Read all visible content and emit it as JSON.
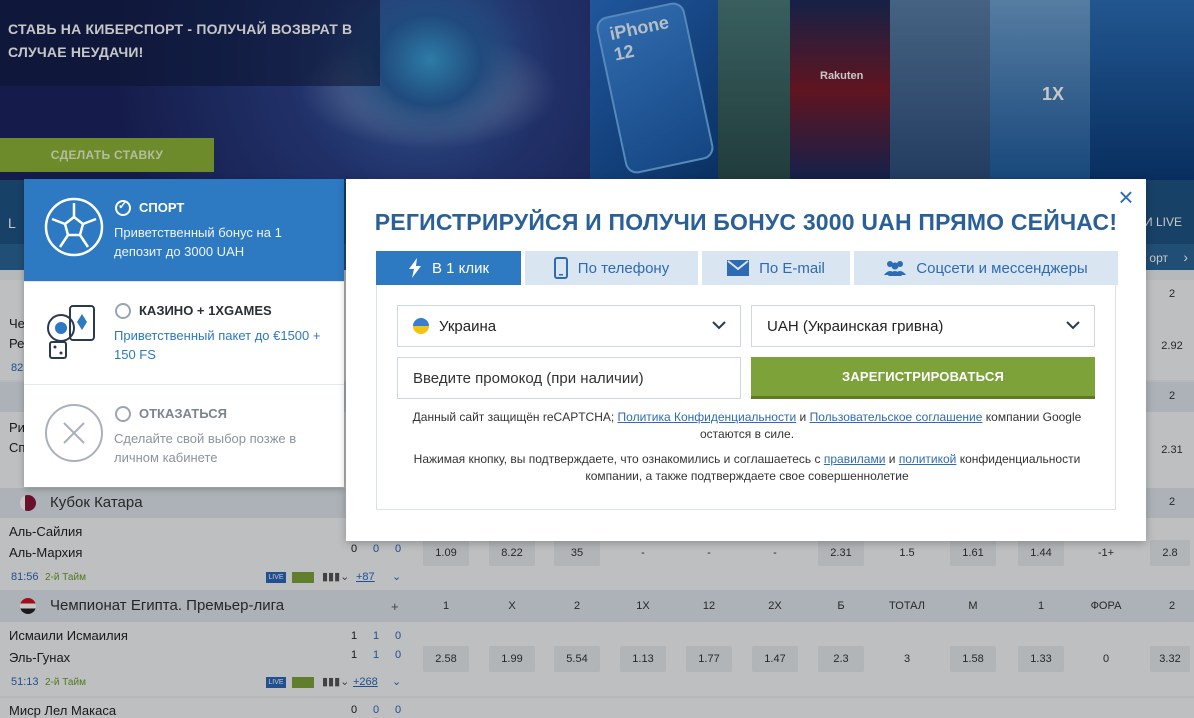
{
  "banner": {
    "promo_text": "СТАВЬ НА КИБЕРСПОРТ - ПОЛУЧАЙ ВОЗВРАТ В СЛУЧАЕ НЕУДАЧИ!",
    "bet_button": "СДЕЛАТЬ СТАВКУ",
    "tile_iphone": "iPhone 12",
    "tile_rakuten": "Rakuten",
    "tile_1x": "1X"
  },
  "background": {
    "nav_left": "L",
    "nav_live": "И LIVE",
    "nav_sub_right": "орт",
    "leagues": [
      {
        "name": "Кубок Катара",
        "plus": "",
        "right": "2"
      },
      {
        "name": "Чемпионат Египта. Премьер-лига",
        "plus": "+",
        "right": "2"
      }
    ],
    "partial_teams": [
      "Че",
      "Ре",
      "Ри",
      "Сп"
    ],
    "partial_row_label": "82",
    "partial_right_values": [
      "2",
      "2.92",
      "2",
      "2.31"
    ],
    "match1": {
      "team1": "Аль-Сайлия",
      "team2": "Аль-Мархия",
      "score1": [
        "0",
        "0",
        "0"
      ],
      "timer": "81:56",
      "half": "2-й Тайм",
      "more": "+87",
      "odds": [
        "1.09",
        "8.22",
        "35",
        "-",
        "-",
        "-",
        "2.31",
        "1.5",
        "1.61",
        "1.44",
        "-1+",
        "2.8"
      ]
    },
    "columns": [
      "1",
      "X",
      "2",
      "1X",
      "12",
      "2X",
      "Б",
      "ТОТАЛ",
      "М",
      "1",
      "ФОРА",
      "2"
    ],
    "match2": {
      "team1": "Исмаили Исмаилия",
      "team2": "Эль-Гунах",
      "score1": [
        "1",
        "1",
        "0"
      ],
      "score2": [
        "1",
        "1",
        "0"
      ],
      "timer": "51:13",
      "half": "2-й Тайм",
      "more": "+268",
      "odds": [
        "2.58",
        "1.99",
        "5.54",
        "1.13",
        "1.77",
        "1.47",
        "2.3",
        "3",
        "1.58",
        "1.33",
        "0",
        "3.32"
      ]
    },
    "match3": {
      "team1": "Миср Лел Макаса",
      "score1": [
        "0",
        "0",
        "0"
      ]
    },
    "live_label": "LIVE"
  },
  "bonus_panel": {
    "options": [
      {
        "title": "СПОРТ",
        "desc": "Приветственный бонус на 1 депозит до 3000 UAH",
        "selected": true
      },
      {
        "title": "КАЗИНО + 1XGAMES",
        "desc": "Приветственный пакет до €1500 + 150 FS",
        "selected": false
      },
      {
        "title": "ОТКАЗАТЬСЯ",
        "desc": "Сделайте свой выбор позже в личном кабинете",
        "selected": false
      }
    ]
  },
  "modal": {
    "title": "РЕГИСТРИРУЙСЯ И ПОЛУЧИ БОНУС 3000 UAH ПРЯМО СЕЙЧАС!",
    "close_icon": "×",
    "tabs": [
      {
        "label": "В 1 клик",
        "icon": "lightning-icon"
      },
      {
        "label": "По телефону",
        "icon": "phone-icon"
      },
      {
        "label": "По E-mail",
        "icon": "envelope-icon"
      },
      {
        "label": "Соцсети и мессенджеры",
        "icon": "people-icon"
      }
    ],
    "country": "Украина",
    "currency": "UAH (Украинская гривна)",
    "promo_placeholder": "Введите промокод (при наличии)",
    "register_button": "ЗАРЕГИСТРИРОВАТЬСЯ",
    "recaptcha": {
      "prefix": "Данный сайт защищён reCAPTCHA;",
      "link1": "Политика Конфиденциальности",
      "and": "и",
      "link2": "Пользовательское соглашение",
      "suffix": "компании Google остаются в силе."
    },
    "consent": {
      "prefix": "Нажимая кнопку, вы подтверждаете, что ознакомились и соглашаетесь с",
      "link1": "правилами",
      "and": "и",
      "link2": "политикой",
      "suffix": "конфиденциальности компании, а также подтверждаете свое совершеннолетие"
    }
  },
  "colors": {
    "accent_blue": "#2d79c2",
    "title_blue": "#2b5f98",
    "register_green": "#7da23a"
  }
}
